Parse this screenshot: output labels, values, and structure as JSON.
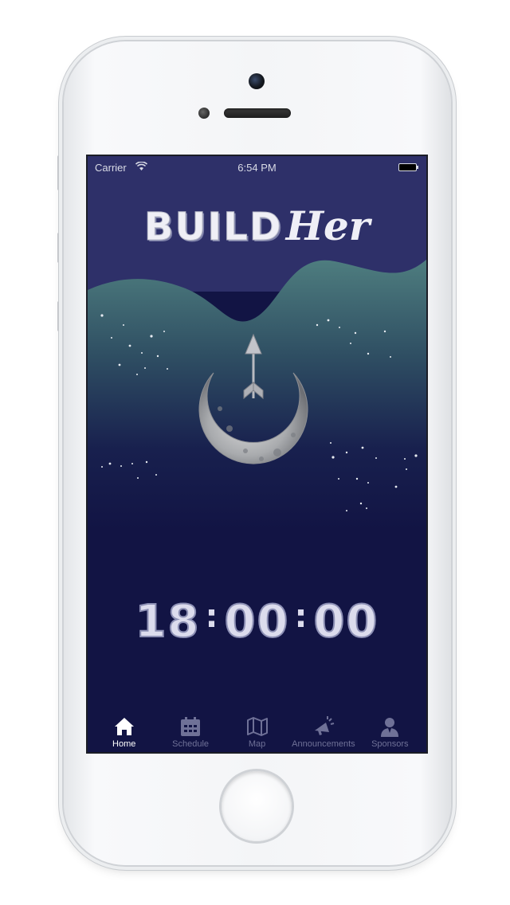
{
  "status_bar": {
    "carrier": "Carrier",
    "time": "6:54 PM",
    "icons": [
      "wifi-icon",
      "battery-icon"
    ]
  },
  "header": {
    "logo_word1": "BUILD",
    "logo_word2": "Her"
  },
  "emblem": {
    "icon": "crescent-moon-arrow-icon"
  },
  "countdown": {
    "hours": "18",
    "minutes": "00",
    "seconds": "00",
    "separator": ":"
  },
  "tab_bar": {
    "active": "Home",
    "items": [
      {
        "label": "Home",
        "icon": "home-icon"
      },
      {
        "label": "Schedule",
        "icon": "calendar-icon"
      },
      {
        "label": "Map",
        "icon": "map-icon"
      },
      {
        "label": "Announcements",
        "icon": "megaphone-icon"
      },
      {
        "label": "Sponsors",
        "icon": "person-icon"
      }
    ]
  },
  "colors": {
    "screen_top": "#2e3069",
    "screen_bottom": "#121444",
    "wave_teal": "#4a7779",
    "tab_active": "#ffffff",
    "tab_inactive": "#6f7197"
  }
}
